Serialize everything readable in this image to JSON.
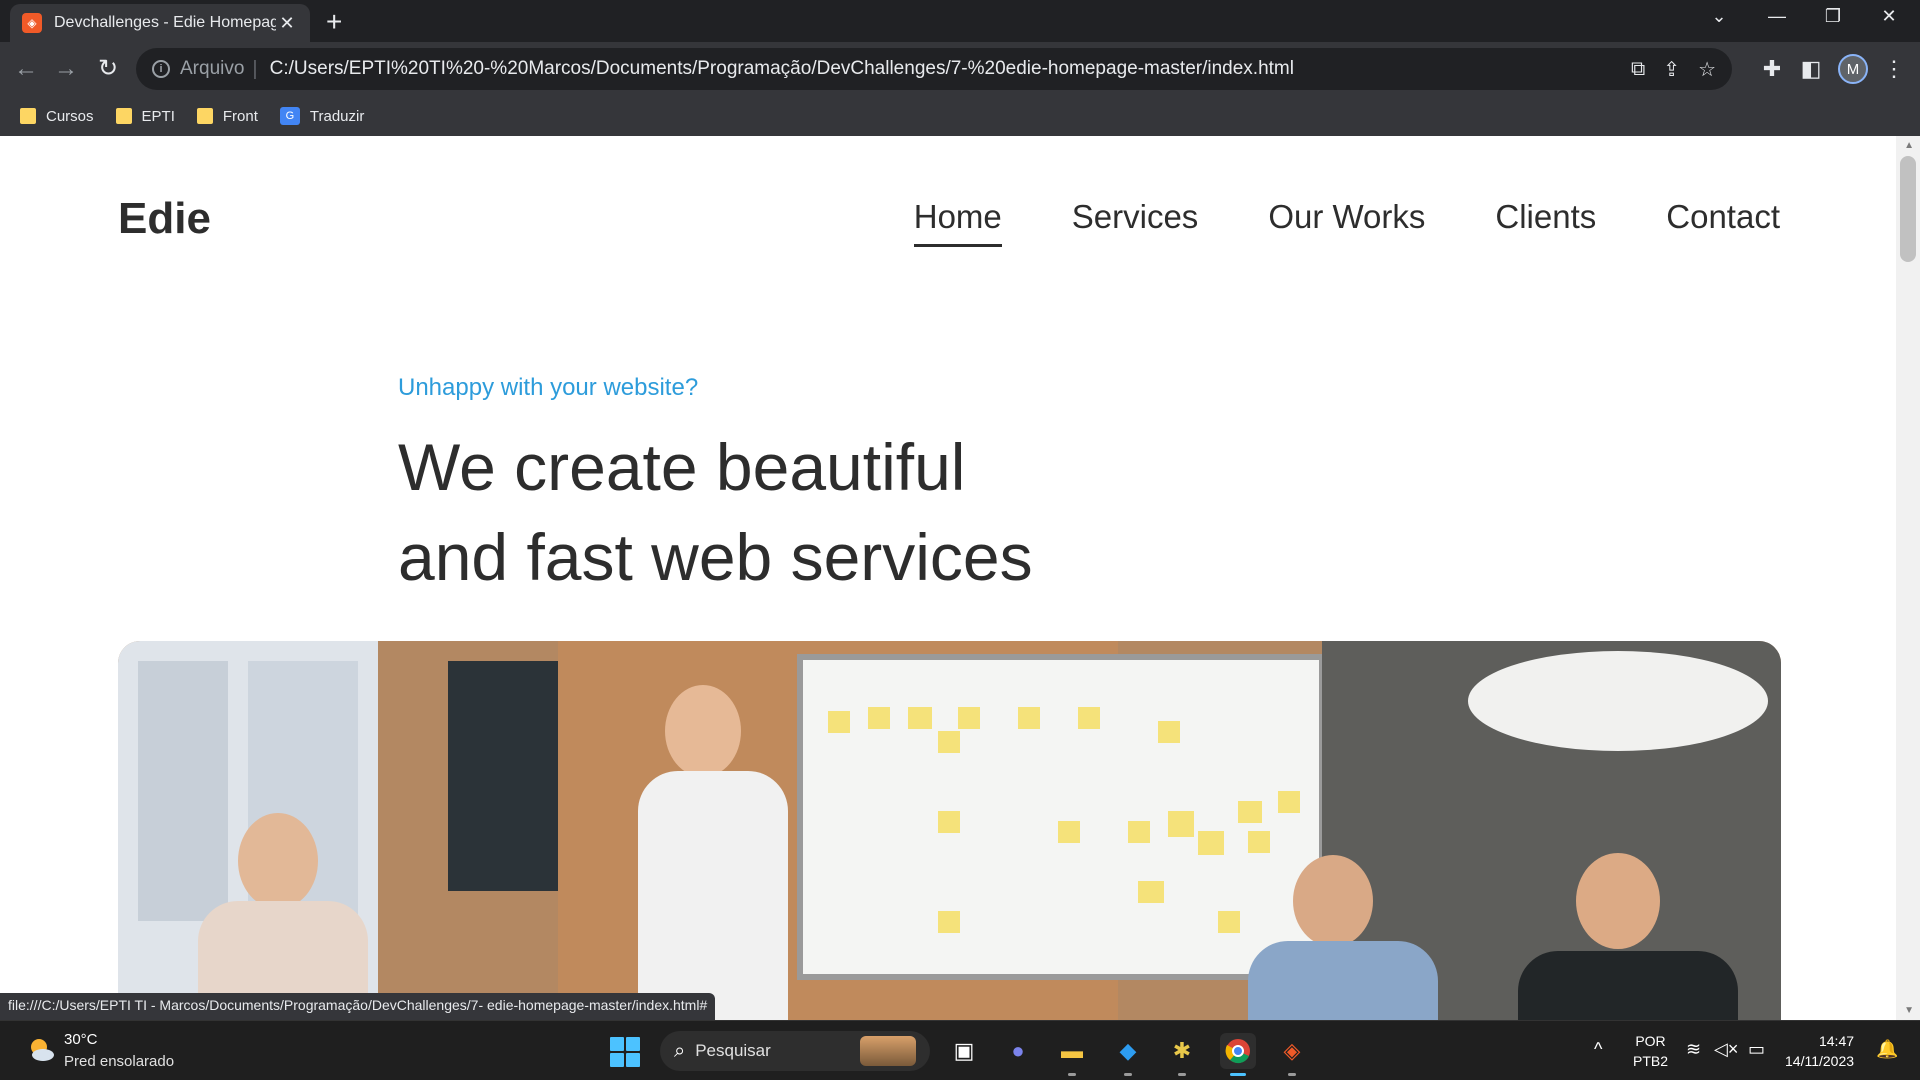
{
  "browser": {
    "tab_title": "Devchallenges - Edie Homepage",
    "omnibox_label": "Arquivo",
    "url": "C:/Users/EPTI%20TI%20-%20Marcos/Documents/Programação/DevChallenges/7-%20edie-homepage-master/index.html",
    "bookmarks": [
      "Cursos",
      "EPTI",
      "Front",
      "Traduzir"
    ],
    "profile_initial": "M",
    "status_url": "file:///C:/Users/EPTI TI - Marcos/Documents/Programação/DevChallenges/7- edie-homepage-master/index.html#"
  },
  "page": {
    "logo": "Edie",
    "nav": [
      "Home",
      "Services",
      "Our Works",
      "Clients",
      "Contact"
    ],
    "active_nav": "Home",
    "eyebrow": "Unhappy with your website?",
    "headline_line1": "We create beautiful",
    "headline_line2": "and fast web services",
    "accent_color": "#2d9cdb"
  },
  "taskbar": {
    "weather_temp": "30°C",
    "weather_desc": "Pred ensolarado",
    "search_placeholder": "Pesquisar",
    "lang": "POR",
    "layout": "PTB2",
    "time": "14:47",
    "date": "14/11/2023"
  }
}
